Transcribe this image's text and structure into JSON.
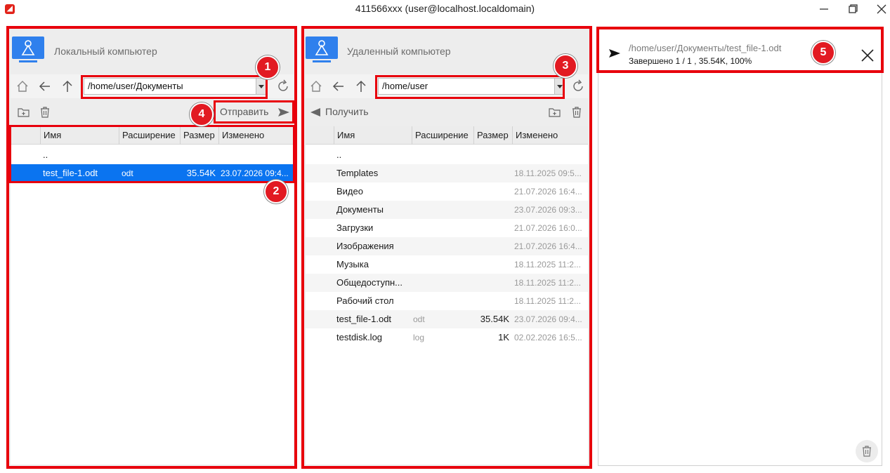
{
  "window": {
    "title": "411566ххх (user@localhost.localdomain)"
  },
  "local": {
    "title": "Локальный компьютер",
    "path": "/home/user/Документы",
    "send_label": "Отправить",
    "columns": [
      "Имя",
      "Расширение",
      "Размер",
      "Изменено"
    ],
    "files": [
      {
        "name": "..",
        "ext": "",
        "size": "",
        "modified": ""
      },
      {
        "name": "test_file-1.odt",
        "ext": "odt",
        "size": "35.54K",
        "modified": "23.07.2026 09:4...",
        "selected": true
      }
    ]
  },
  "remote": {
    "title": "Удаленный компьютер",
    "path": "/home/user",
    "receive_label": "Получить",
    "columns": [
      "Имя",
      "Расширение",
      "Размер",
      "Изменено"
    ],
    "files": [
      {
        "name": "..",
        "ext": "",
        "size": "",
        "modified": ""
      },
      {
        "name": "Templates",
        "ext": "",
        "size": "",
        "modified": "18.11.2025 09:5..."
      },
      {
        "name": "Видео",
        "ext": "",
        "size": "",
        "modified": "21.07.2026 16:4..."
      },
      {
        "name": "Документы",
        "ext": "",
        "size": "",
        "modified": "23.07.2026 09:3..."
      },
      {
        "name": "Загрузки",
        "ext": "",
        "size": "",
        "modified": "21.07.2026 16:0..."
      },
      {
        "name": "Изображения",
        "ext": "",
        "size": "",
        "modified": "21.07.2026 16:4..."
      },
      {
        "name": "Музыка",
        "ext": "",
        "size": "",
        "modified": "18.11.2025 11:2..."
      },
      {
        "name": "Общедоступн...",
        "ext": "",
        "size": "",
        "modified": "18.11.2025 11:2..."
      },
      {
        "name": "Рабочий стол",
        "ext": "",
        "size": "",
        "modified": "18.11.2025 11:2..."
      },
      {
        "name": "test_file-1.odt",
        "ext": "odt",
        "size": "35.54K",
        "modified": "23.07.2026 09:4..."
      },
      {
        "name": "testdisk.log",
        "ext": "log",
        "size": "1K",
        "modified": "02.02.2026 16:5..."
      }
    ]
  },
  "queue": {
    "items": [
      {
        "path": "/home/user/Документы/test_file-1.odt",
        "status": "Завершено 1 / 1 , 35.54K, 100%"
      }
    ]
  },
  "annotations": [
    "1",
    "2",
    "3",
    "4",
    "5"
  ],
  "colors": {
    "highlight": "#e8000c",
    "selection": "#0a74f0",
    "badge": "#e21a22",
    "icon_blue": "#2f80ed"
  }
}
